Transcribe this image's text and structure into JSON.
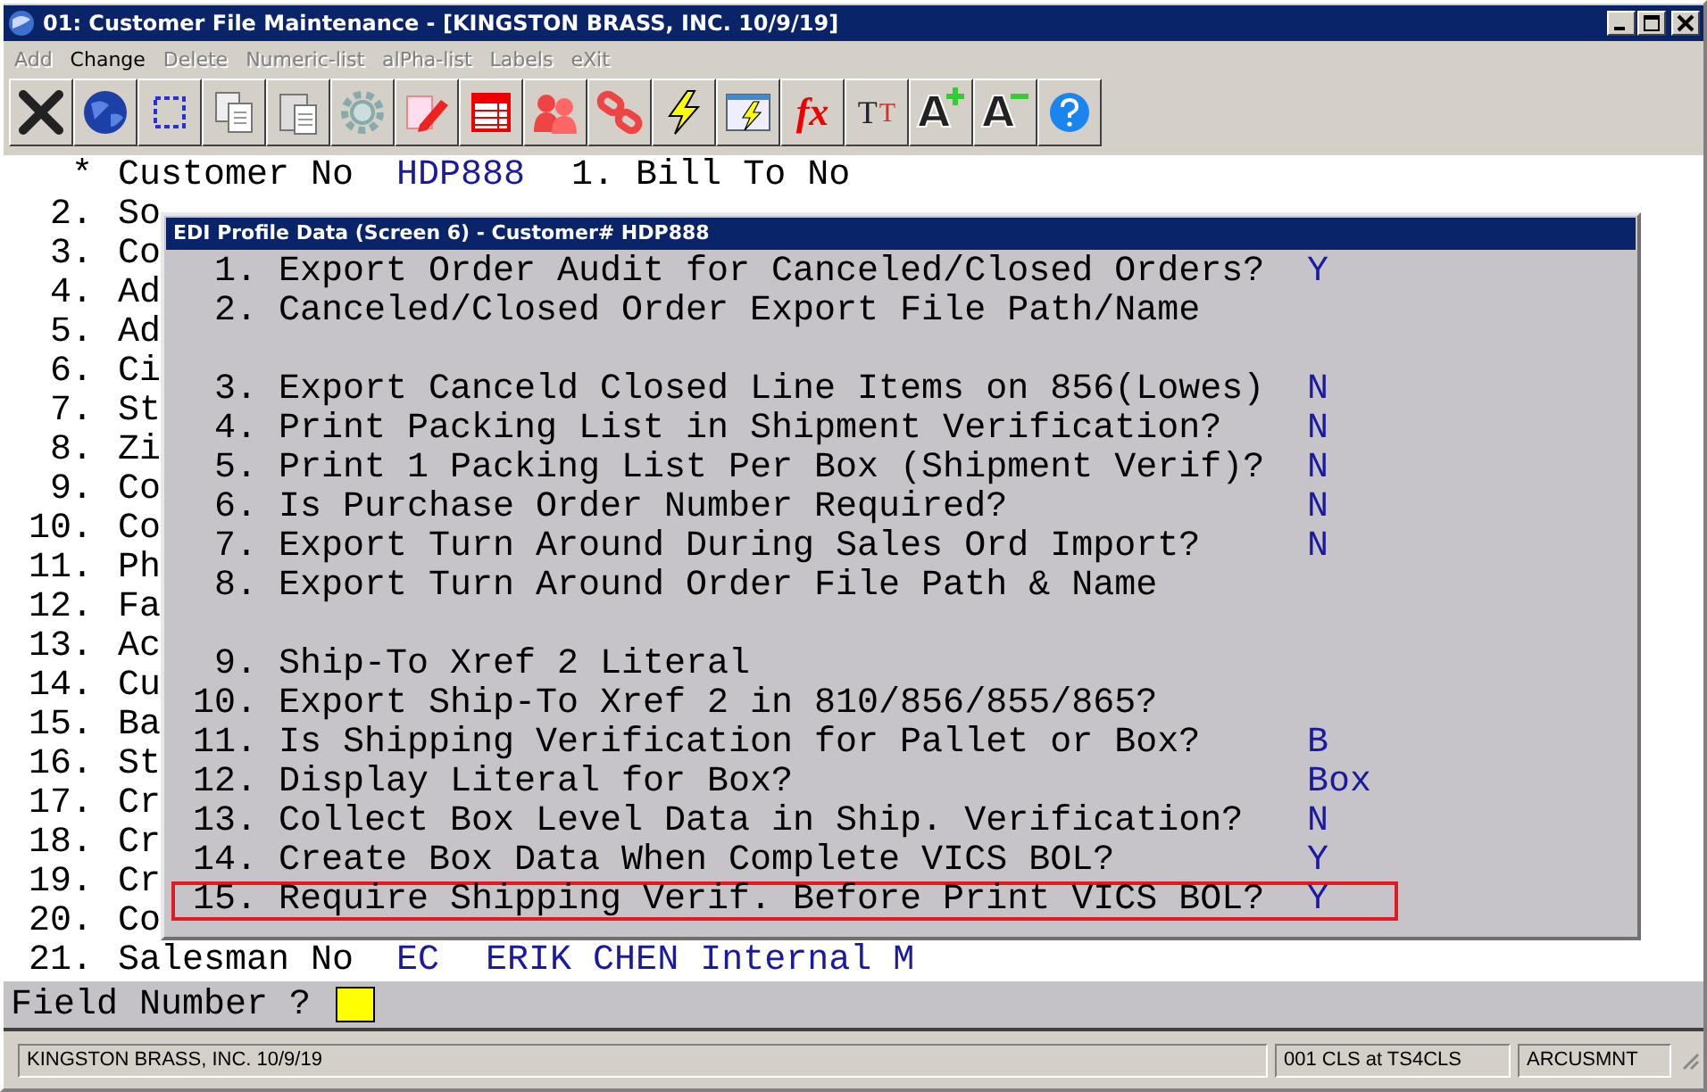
{
  "window": {
    "title": "01: Customer File Maintenance - [KINGSTON BRASS, INC. 10/9/19]"
  },
  "menu": [
    {
      "label": "Add",
      "disabled": true
    },
    {
      "label": "Change",
      "disabled": false
    },
    {
      "label": "Delete",
      "disabled": true
    },
    {
      "label": "Numeric-list",
      "disabled": true
    },
    {
      "label": "alPha-list",
      "disabled": true
    },
    {
      "label": "Labels",
      "disabled": true
    },
    {
      "label": "eXit",
      "disabled": true
    }
  ],
  "toolbar": [
    {
      "kind": "exit"
    },
    {
      "kind": "globe"
    },
    {
      "kind": "select"
    },
    {
      "kind": "copy"
    },
    {
      "kind": "paste"
    },
    {
      "kind": "gear"
    },
    {
      "kind": "edit"
    },
    {
      "kind": "table"
    },
    {
      "kind": "people"
    },
    {
      "kind": "link"
    },
    {
      "kind": "bolt"
    },
    {
      "kind": "window-bolt"
    },
    {
      "kind": "formula",
      "glyph": "fx"
    },
    {
      "kind": "fonts",
      "glyph": "T",
      "glyph2": "T"
    },
    {
      "kind": "font-larger",
      "glyph": "A"
    },
    {
      "kind": "font-smaller",
      "glyph": "A"
    },
    {
      "kind": "help"
    }
  ],
  "screen": {
    "header": {
      "marker": "*",
      "label": "Customer No",
      "value": "HDP888",
      "next_field": "1. Bill To No"
    },
    "fields": [
      {
        "number": "2.",
        "label": "So"
      },
      {
        "number": "3.",
        "label": "Co"
      },
      {
        "number": "4.",
        "label": "Ad"
      },
      {
        "number": "5.",
        "label": "Ad"
      },
      {
        "number": "6.",
        "label": "Ci"
      },
      {
        "number": "7.",
        "label": "St"
      },
      {
        "number": "8.",
        "label": "Zi"
      },
      {
        "number": "9.",
        "label": "Co"
      },
      {
        "number": "10.",
        "label": "Co"
      },
      {
        "number": "11.",
        "label": "Ph"
      },
      {
        "number": "12.",
        "label": "Fa"
      },
      {
        "number": "13.",
        "label": "Ac"
      },
      {
        "number": "14.",
        "label": "Cu"
      },
      {
        "number": "15.",
        "label": "Ba"
      },
      {
        "number": "16.",
        "label": "St"
      },
      {
        "number": "17.",
        "label": "Cr"
      },
      {
        "number": "18.",
        "label": "Cr"
      },
      {
        "number": "19.",
        "label": "Cr"
      },
      {
        "number": "20.",
        "label": "Co"
      },
      {
        "number": "21.",
        "label": "Salesman No",
        "value": "EC",
        "description": "ERIK CHEN Internal M"
      }
    ]
  },
  "dialog": {
    "title": "EDI Profile Data (Screen 6) - Customer# HDP888",
    "items": [
      {
        "number": "1.",
        "label": "Export Order Audit for Canceled/Closed Orders?",
        "value": "Y",
        "gap_before": false,
        "highlighted": false
      },
      {
        "number": "2.",
        "label": "Canceled/Closed Order Export File Path/Name",
        "gap_before": false,
        "highlighted": false
      },
      {
        "number": "3.",
        "label": "Export Canceld Closed Line Items on 856(Lowes)",
        "value": "N",
        "gap_before": true,
        "highlighted": false
      },
      {
        "number": "4.",
        "label": "Print Packing List in Shipment Verification?",
        "value": "N",
        "gap_before": false,
        "highlighted": false
      },
      {
        "number": "5.",
        "label": "Print 1 Packing List Per Box (Shipment Verif)?",
        "value": "N",
        "gap_before": false,
        "highlighted": false
      },
      {
        "number": "6.",
        "label": "Is Purchase Order Number Required?",
        "value": "N",
        "gap_before": false,
        "highlighted": false
      },
      {
        "number": "7.",
        "label": "Export Turn Around During Sales Ord Import?",
        "value": "N",
        "gap_before": false,
        "highlighted": false
      },
      {
        "number": "8.",
        "label": "Export Turn Around Order File Path & Name",
        "gap_before": false,
        "highlighted": false
      },
      {
        "number": "9.",
        "label": "Ship-To Xref 2 Literal",
        "gap_before": true,
        "highlighted": false
      },
      {
        "number": "10.",
        "label": "Export Ship-To Xref 2 in 810/856/855/865?",
        "gap_before": false,
        "highlighted": false
      },
      {
        "number": "11.",
        "label": "Is Shipping Verification for Pallet or Box?",
        "value": "B",
        "gap_before": false,
        "highlighted": false
      },
      {
        "number": "12.",
        "label": "Display Literal for Box?",
        "value": "Box",
        "gap_before": false,
        "highlighted": false
      },
      {
        "number": "13.",
        "label": "Collect Box Level Data in Ship. Verification?",
        "value": "N",
        "gap_before": false,
        "highlighted": false
      },
      {
        "number": "14.",
        "label": "Create Box Data When Complete VICS BOL?",
        "value": "Y",
        "gap_before": false,
        "highlighted": false
      },
      {
        "number": "15.",
        "label": "Require Shipping Verif. Before Print VICS BOL?",
        "value": "Y",
        "gap_before": false,
        "highlighted": true
      }
    ]
  },
  "prompt": {
    "label": "Field Number ?"
  },
  "status_bar": [
    "KINGSTON BRASS, INC. 10/9/19",
    "001 CLS at TS4CLS",
    "ARCUSMNT"
  ]
}
